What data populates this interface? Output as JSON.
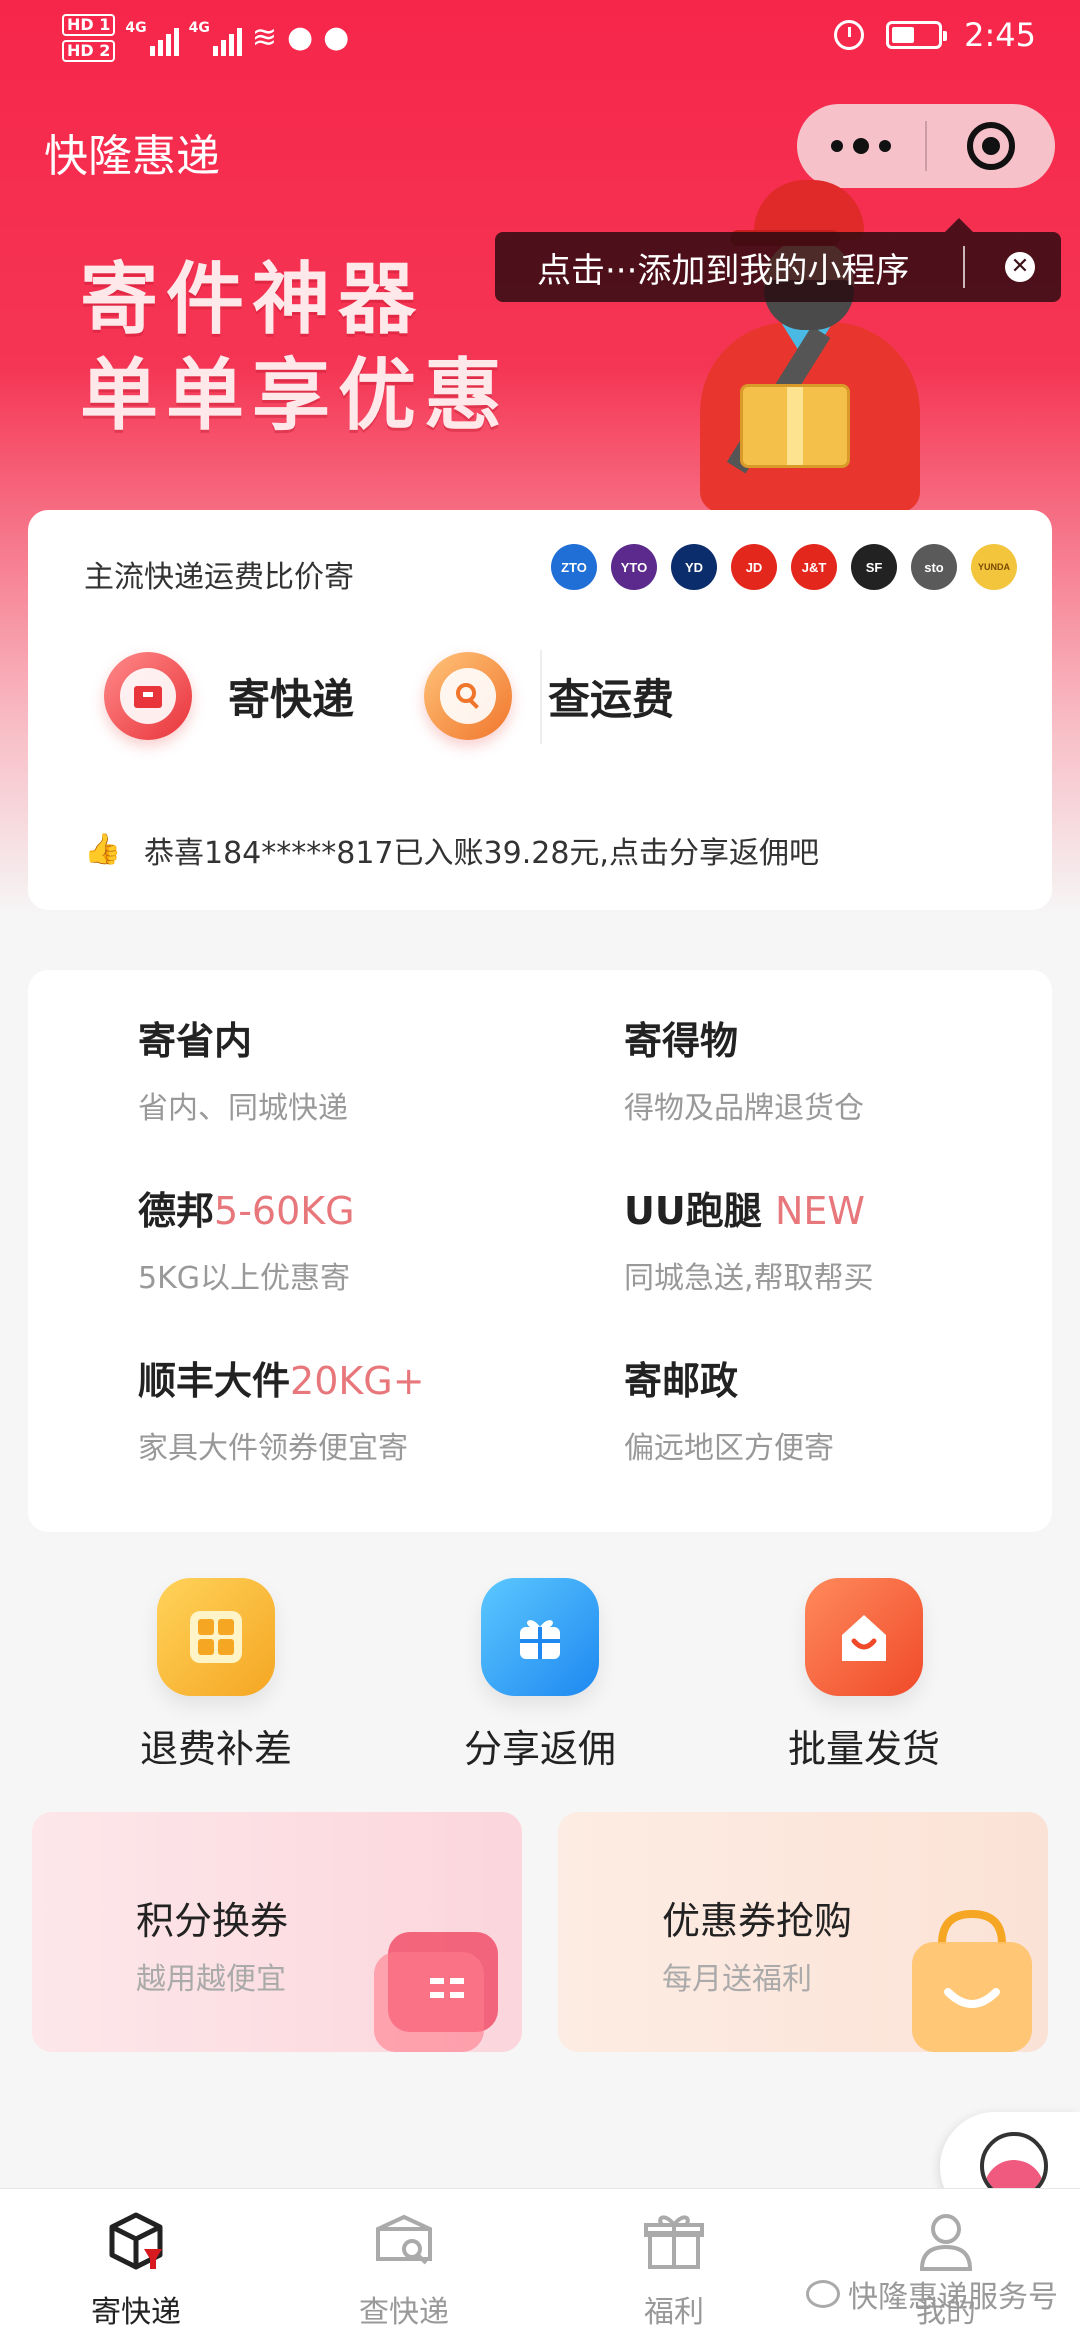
{
  "status_bar": {
    "time": "2:45",
    "hd1": "HD 1",
    "hd2": "HD 2",
    "net1": "4G",
    "net2": "4G",
    "battery_level": 0.5
  },
  "header": {
    "title": "快隆惠递",
    "tip_text": "点击···添加到我的小程序"
  },
  "hero": {
    "slogan_line1": "寄件神器",
    "slogan_line2": "单单享优惠"
  },
  "compare": {
    "title": "主流快递运费比价寄",
    "logos": [
      {
        "name": "ZTO",
        "color": "#1f6fd6"
      },
      {
        "name": "YTO",
        "color": "#5b2a8c"
      },
      {
        "name": "YD",
        "color": "#0c2d6b"
      },
      {
        "name": "JD",
        "color": "#e3271c"
      },
      {
        "name": "J&T",
        "color": "#e3271c"
      },
      {
        "name": "SF",
        "color": "#222222"
      },
      {
        "name": "sto",
        "color": "#5a5a5a"
      },
      {
        "name": "YUNDA",
        "color": "#f2c53d"
      }
    ],
    "send_label": "寄快递",
    "check_label": "查运费",
    "notice": "恭喜184*****817已入账39.28元,点击分享返佣吧"
  },
  "services": [
    {
      "title": "寄省内",
      "highlight": "",
      "desc": "省内、同城快递"
    },
    {
      "title": "寄得物",
      "highlight": "",
      "desc": "得物及品牌退货仓"
    },
    {
      "title": "德邦",
      "highlight": "5-60KG",
      "desc": "5KG以上优惠寄"
    },
    {
      "title": "UU跑腿 ",
      "highlight": "NEW",
      "desc": "同城急送,帮取帮买"
    },
    {
      "title": "顺丰大件",
      "highlight": "20KG+",
      "desc": "家具大件领券便宜寄"
    },
    {
      "title": "寄邮政",
      "highlight": "",
      "desc": "偏远地区方便寄"
    }
  ],
  "quick": [
    {
      "label": "退费补差"
    },
    {
      "label": "分享返佣"
    },
    {
      "label": "批量发货"
    }
  ],
  "promos": [
    {
      "title": "积分换券",
      "subtitle": "越用越便宜"
    },
    {
      "title": "优惠券抢购",
      "subtitle": "每月送福利"
    }
  ],
  "tabs": [
    {
      "label": "寄快递"
    },
    {
      "label": "查快递"
    },
    {
      "label": "福利"
    },
    {
      "label": "我的"
    }
  ],
  "watermark": "快隆惠递服务号",
  "colors": {
    "brand_red": "#f6264a",
    "highlight": "#e8777c"
  }
}
